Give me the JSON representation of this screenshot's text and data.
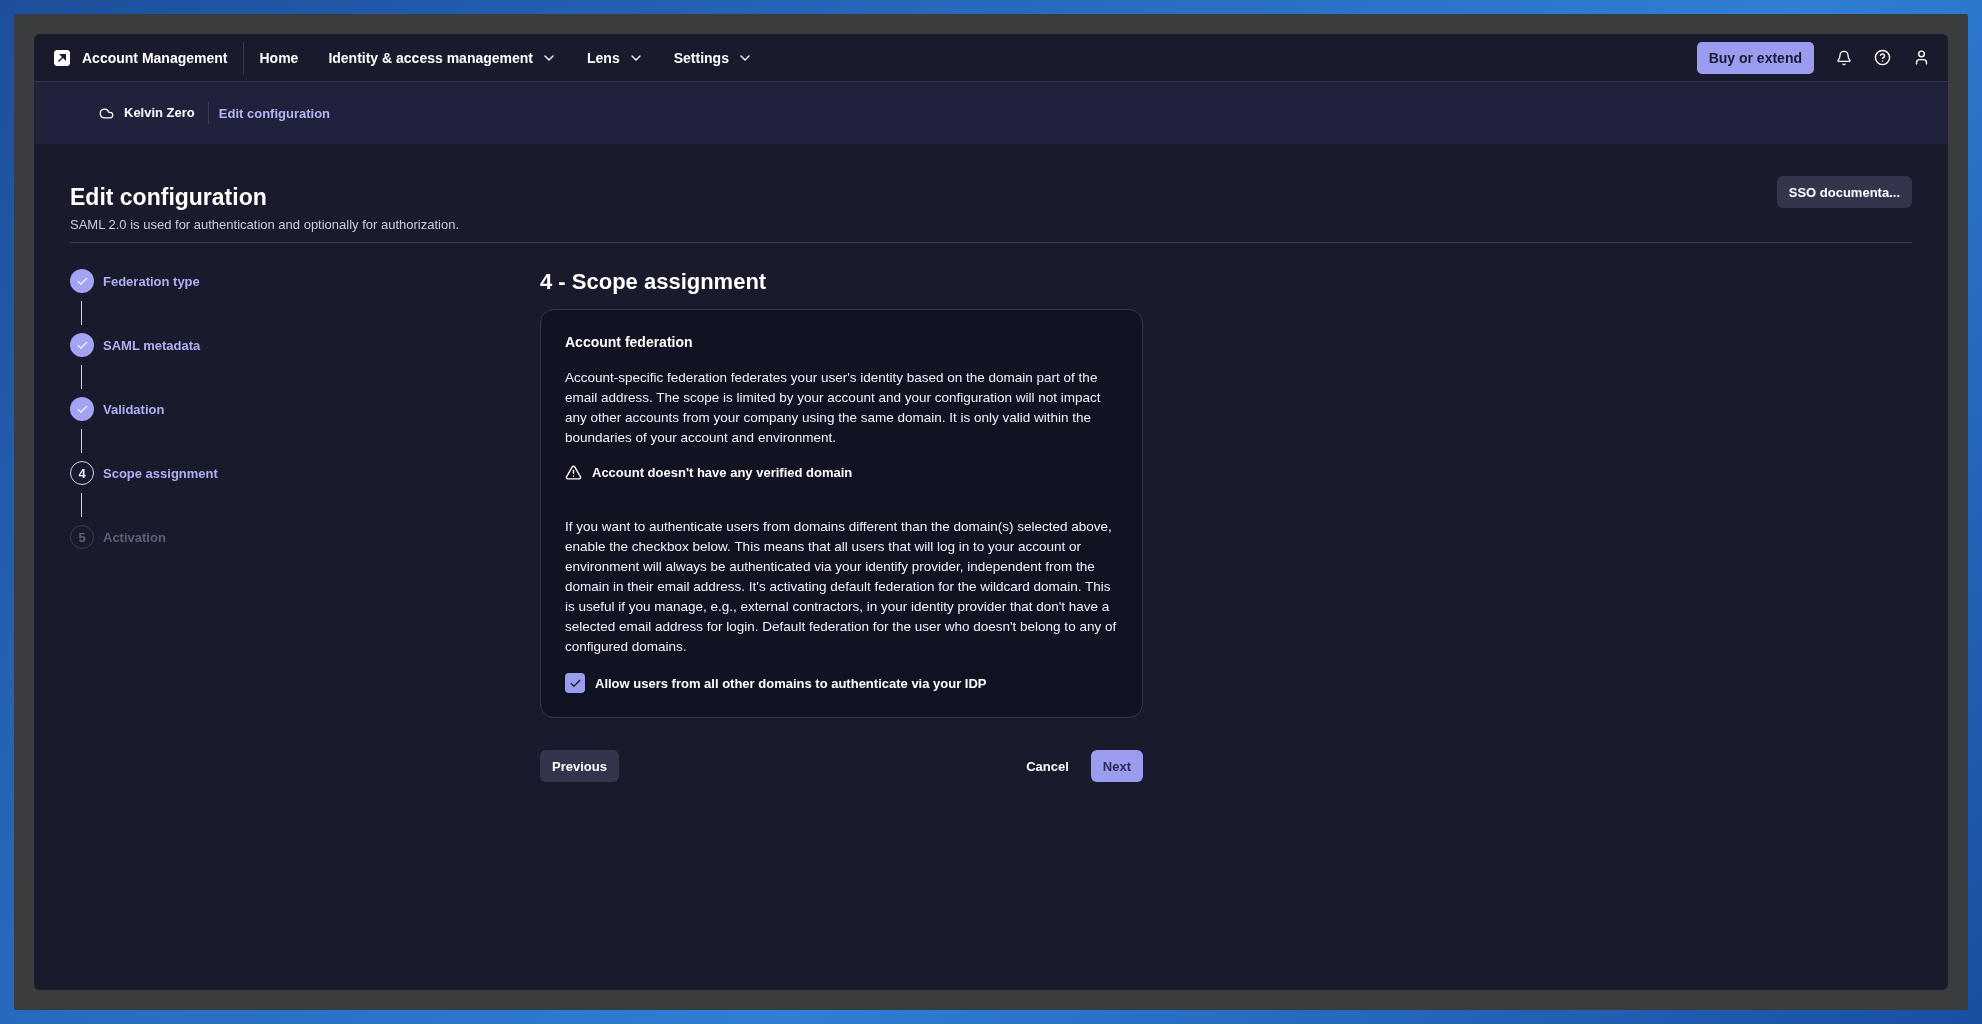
{
  "nav": {
    "brand": "Account Management",
    "items": [
      {
        "label": "Home",
        "dropdown": false
      },
      {
        "label": "Identity & access management",
        "dropdown": true
      },
      {
        "label": "Lens",
        "dropdown": true
      },
      {
        "label": "Settings",
        "dropdown": true
      }
    ],
    "primary_button": "Buy or extend"
  },
  "breadcrumb": {
    "account": "Kelvin Zero",
    "current": "Edit configuration"
  },
  "header": {
    "title": "Edit configuration",
    "subtitle": "SAML 2.0 is used for authentication and optionally for authorization.",
    "doc_button": "SSO documenta..."
  },
  "steps": [
    {
      "label": "Federation type",
      "completed": true,
      "selected": false
    },
    {
      "label": "SAML metadata",
      "completed": true,
      "selected": false
    },
    {
      "label": "Validation",
      "completed": true,
      "selected": false
    },
    {
      "label": "Scope assignment",
      "completed": false,
      "selected": true,
      "number": "4"
    },
    {
      "label": "Activation",
      "completed": false,
      "selected": false,
      "number": "5"
    }
  ],
  "section": {
    "heading": "4 - Scope assignment",
    "card_title": "Account federation",
    "intro": "Account-specific federation federates your user's identity based on the domain part of the email address. The scope is limited by your account and your configuration will not impact any other accounts from your company using the same domain. It is only valid within the boundaries of your account and environment.",
    "warning": "Account doesn't have any verified domain",
    "explanation": "If you want to authenticate users from domains different than the domain(s) selected above, enable the checkbox below. This means that all users that will log in to your account or environment will always be authenticated via your identify provider, independent from the domain in their email address. It's activating default federation for the wildcard domain. This is useful if you manage, e.g., external contractors, in your identity provider that don't have a selected email address for login. Default federation for the user who doesn't belong to any of configured domains.",
    "checkbox": {
      "label": "Allow users from all other domains to authenticate via your IDP",
      "checked": true
    }
  },
  "actions": {
    "previous": "Previous",
    "cancel": "Cancel",
    "next": "Next"
  }
}
